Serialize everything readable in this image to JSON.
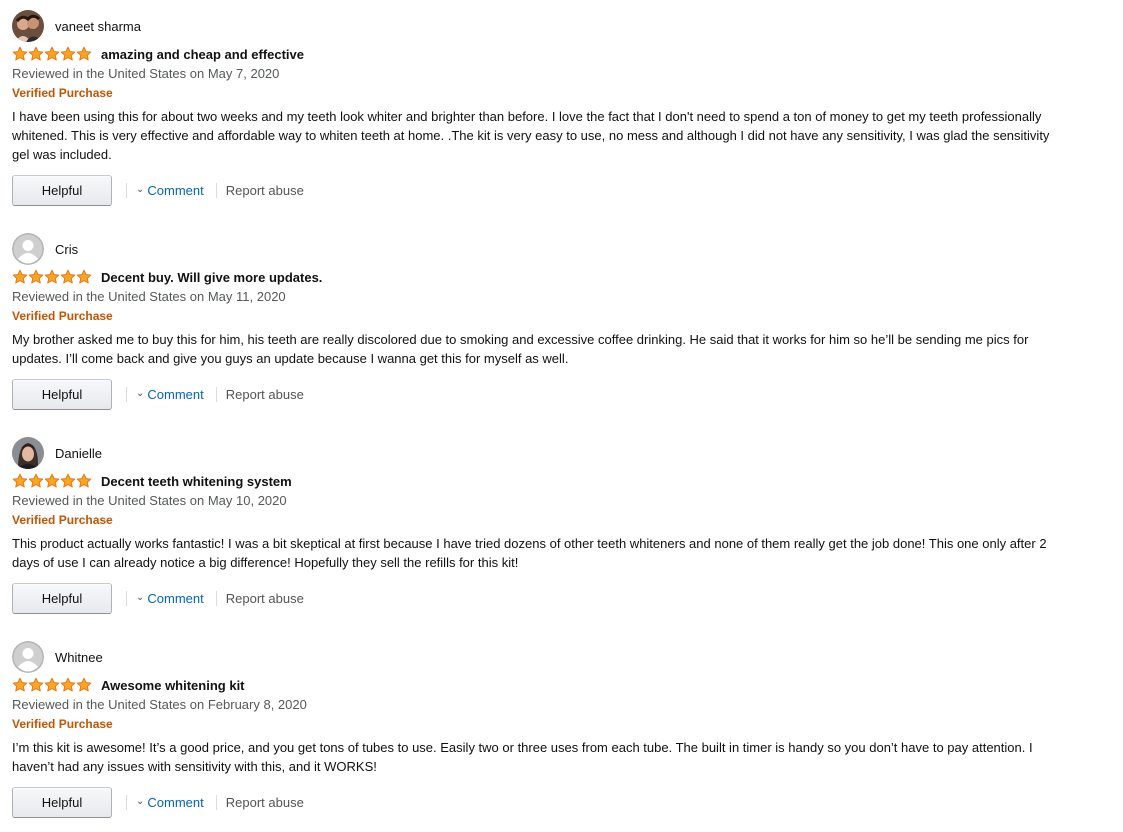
{
  "colors": {
    "star_fill": "#ffa41c",
    "star_stroke": "#de7921",
    "verified": "#c45500",
    "link": "#0066c0",
    "date": "#565959"
  },
  "icons": {
    "star": "star-icon",
    "chevron": "chevron-down-icon",
    "default_avatar": "default-avatar-icon"
  },
  "reviews": [
    {
      "name": "vaneet sharma",
      "avatar": "photo",
      "rating": 5,
      "title": "amazing and cheap and effective",
      "date": "Reviewed in the United States on May 7, 2020",
      "verified": "Verified Purchase",
      "body": "I have been using this for about two weeks and my teeth look whiter and brighter than before. I love the fact that I don't need to spend a ton of money to get my teeth professionally whitened. This is very effective and affordable way to whiten teeth at home. .The kit is very easy to use, no mess and although I did not have any sensitivity, I was glad the sensitivity gel was included.",
      "helpful": "Helpful",
      "comment": "Comment",
      "report": "Report abuse"
    },
    {
      "name": "Cris",
      "avatar": "default",
      "rating": 5,
      "title": "Decent buy. Will give more updates.",
      "date": "Reviewed in the United States on May 11, 2020",
      "verified": "Verified Purchase",
      "body": "My brother asked me to buy this for him, his teeth are really discolored due to smoking and excessive coffee drinking. He said that it works for him so he’ll be sending me pics for updates. I’ll come back and give you guys an update because I wanna get this for myself as well.",
      "helpful": "Helpful",
      "comment": "Comment",
      "report": "Report abuse"
    },
    {
      "name": "Danielle",
      "avatar": "photo",
      "rating": 5,
      "title": "Decent teeth whitening system",
      "date": "Reviewed in the United States on May 10, 2020",
      "verified": "Verified Purchase",
      "body": "This product actually works fantastic! I was a bit skeptical at first because I have tried dozens of other teeth whiteners and none of them really get the job done! This one only after 2 days of use I can already notice a big difference! Hopefully they sell the refills for this kit!",
      "helpful": "Helpful",
      "comment": "Comment",
      "report": "Report abuse"
    },
    {
      "name": "Whitnee",
      "avatar": "default",
      "rating": 5,
      "title": "Awesome whitening kit",
      "date": "Reviewed in the United States on February 8, 2020",
      "verified": "Verified Purchase",
      "body": "I’m this kit is awesome! It’s a good price, and you get tons of tubes to use. Easily two or three uses from each tube. The built in timer is handy so you don’t have to pay attention. I haven’t had any issues with sensitivity with this, and it WORKS!",
      "helpful": "Helpful",
      "comment": "Comment",
      "report": "Report abuse"
    }
  ]
}
